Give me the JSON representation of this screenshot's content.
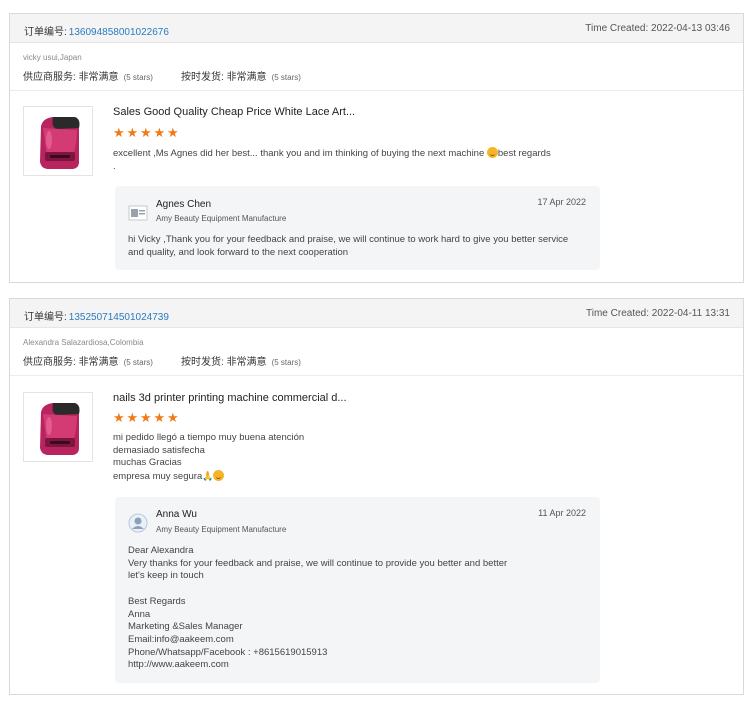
{
  "order_label": "订单编号:",
  "supplier_service_label": "供应商服务:",
  "on_time_delivery_label": "按时发货:",
  "orders": [
    {
      "order_number": "136094858001022676",
      "time_created": "Time Created: 2022-04-13 03:46",
      "buyer": "vicky usui,Japan",
      "supplier_service_value": "非常满意",
      "supplier_service_stars": "(5 stars)",
      "delivery_value": "非常满意",
      "delivery_stars": "(5 stars)",
      "product_title": "Sales Good Quality Cheap Price White Lace Art...",
      "rating": 5,
      "review": "excellent ,Ms Agnes did her best... thank you and im thinking of buying the next machine",
      "review_suffix": "best regards",
      "review_line2": ".",
      "reply": {
        "name": "Agnes Chen",
        "company": "Amy Beauty Equipment Manufacture",
        "date": "17 Apr 2022",
        "text": "hi Vicky ,Thank you for your feedback and praise, we will continue to work hard to give you better service\nand quality, and look forward to the next cooperation"
      }
    },
    {
      "order_number": "135250714501024739",
      "time_created": "Time Created: 2022-04-11 13:31",
      "buyer": "Alexandra Salazardiosa,Colombia",
      "supplier_service_value": "非常满意",
      "supplier_service_stars": "(5 stars)",
      "delivery_value": "非常满意",
      "delivery_stars": "(5 stars)",
      "product_title": "nails 3d printer printing machine commercial d...",
      "rating": 5,
      "review": "mi pedido llegó a tiempo muy buena atención\ndemasiado satisfecha\nmuchas Gracias\nempresa muy segura",
      "reply": {
        "name": "Anna Wu",
        "company": "Amy Beauty Equipment Manufacture",
        "date": "11 Apr 2022",
        "text": "Dear Alexandra\nVery thanks for your feedback and praise, we will continue to provide you better and better\nlet's keep in touch\n\nBest Regards\nAnna\nMarketing &Sales Manager\nEmail:info@aakeem.com\nPhone/Whatsapp/Facebook : +8615619015913\nhttp://www.aakeem.com"
      }
    }
  ],
  "colors": {
    "order_link": "#2a7ac0",
    "star": "#f07a16",
    "reply_bg": "#f4f5f7"
  },
  "icons": {
    "star": "star-icon",
    "emoji": "smiling-face-emoji-icon",
    "folded_hands": "folded-hands-emoji-icon"
  }
}
